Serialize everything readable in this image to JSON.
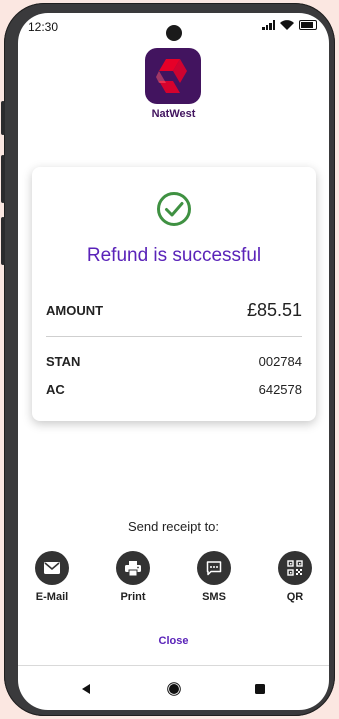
{
  "status_bar": {
    "time": "12:30"
  },
  "brand": {
    "name": "NatWest",
    "logo_color": "#42145f",
    "logo_mark_color": "#e60028"
  },
  "card": {
    "title": "Refund is successful",
    "rows": [
      {
        "label": "AMOUNT",
        "value": "£85.51"
      },
      {
        "label": "STAN",
        "value": "002784"
      },
      {
        "label": "AC",
        "value": "642578"
      }
    ]
  },
  "receipt": {
    "label": "Send receipt to:",
    "options": [
      {
        "label": "E-Mail",
        "icon": "mail-icon"
      },
      {
        "label": "Print",
        "icon": "printer-icon"
      },
      {
        "label": "SMS",
        "icon": "sms-icon"
      },
      {
        "label": "QR",
        "icon": "qr-code-icon"
      }
    ]
  },
  "close_label": "Close",
  "colors": {
    "accent": "#5a23b9",
    "success": "#3f9142"
  }
}
